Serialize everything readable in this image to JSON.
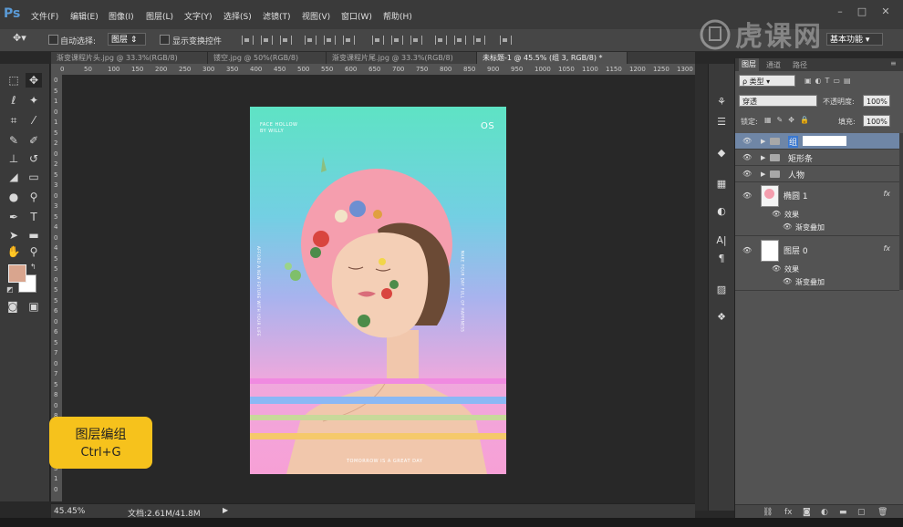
{
  "app": {
    "logo": "Ps"
  },
  "menu": [
    "文件(F)",
    "编辑(E)",
    "图像(I)",
    "图层(L)",
    "文字(Y)",
    "选择(S)",
    "滤镜(T)",
    "视图(V)",
    "窗口(W)",
    "帮助(H)"
  ],
  "options": {
    "auto_select_label": "自动选择:",
    "auto_select_value": "图层",
    "show_transform_label": "显示变换控件",
    "workspace": "基本功能"
  },
  "tabs": [
    "渐变课程片头.jpg @ 33.3%(RGB/8)",
    "镂空.jpg @ 50%(RGB/8)",
    "渐变课程片尾.jpg @ 33.3%(RGB/8)",
    "未标题-1 @ 45.5% (组 3, RGB/8) *"
  ],
  "ruler": {
    "h": [
      "0",
      "50",
      "100",
      "150",
      "200",
      "250",
      "300",
      "350",
      "400",
      "450",
      "500",
      "550",
      "600",
      "650",
      "700",
      "750",
      "800",
      "850",
      "900",
      "950",
      "1000",
      "1050",
      "1100",
      "1150",
      "1200",
      "1250",
      "1300"
    ],
    "v": [
      "0",
      "5",
      "1",
      "0",
      "1",
      "5",
      "2",
      "0",
      "2",
      "5",
      "3",
      "0",
      "3",
      "5",
      "4",
      "0",
      "4",
      "5",
      "5",
      "0",
      "5",
      "5",
      "6",
      "0",
      "6",
      "5",
      "7",
      "0",
      "7",
      "5",
      "8",
      "0",
      "8",
      "5",
      "9",
      "0",
      "9",
      "5",
      "1",
      "0"
    ]
  },
  "poster": {
    "top_left_line1": "FACE HOLLOW",
    "top_left_line2": "BY WILLY",
    "top_right": "OS",
    "bottom_text": "TOMORROW IS A GREAT DAY",
    "side_left": "AFFORD A NEW FUTURE WITH YOUR LIFE",
    "side_right": "MAKE YOUR DAY FULL OF HAPPINESS"
  },
  "status": {
    "zoom": "45.45%",
    "doc": "文档:2.61M/41.8M"
  },
  "layers_panel": {
    "tabs": [
      "图层",
      "通道",
      "路径"
    ],
    "filter": "ρ 类型",
    "blend_mode": "穿透",
    "opacity_label": "不透明度:",
    "opacity_value": "100%",
    "lock_label": "锁定:",
    "fill_label": "填充:",
    "fill_value": "100%",
    "layers": [
      {
        "name": "组",
        "type": "group",
        "selected": true
      },
      {
        "name": "矩形条",
        "type": "group"
      },
      {
        "name": "人物",
        "type": "group"
      },
      {
        "name": "椭圆 1",
        "type": "shape",
        "fx": "fx",
        "effects_label": "效果",
        "effect": "渐变叠加"
      },
      {
        "name": "图层 0",
        "type": "pixel",
        "fx": "fx",
        "effects_label": "效果",
        "effect": "渐变叠加"
      }
    ]
  },
  "hint": {
    "title": "图层编组",
    "shortcut": "Ctrl+G"
  },
  "colors": {
    "accent": "#f6c21c",
    "selected_layer": "#6f86a6",
    "foreground": "#d9a58e",
    "background": "#ffffff"
  }
}
